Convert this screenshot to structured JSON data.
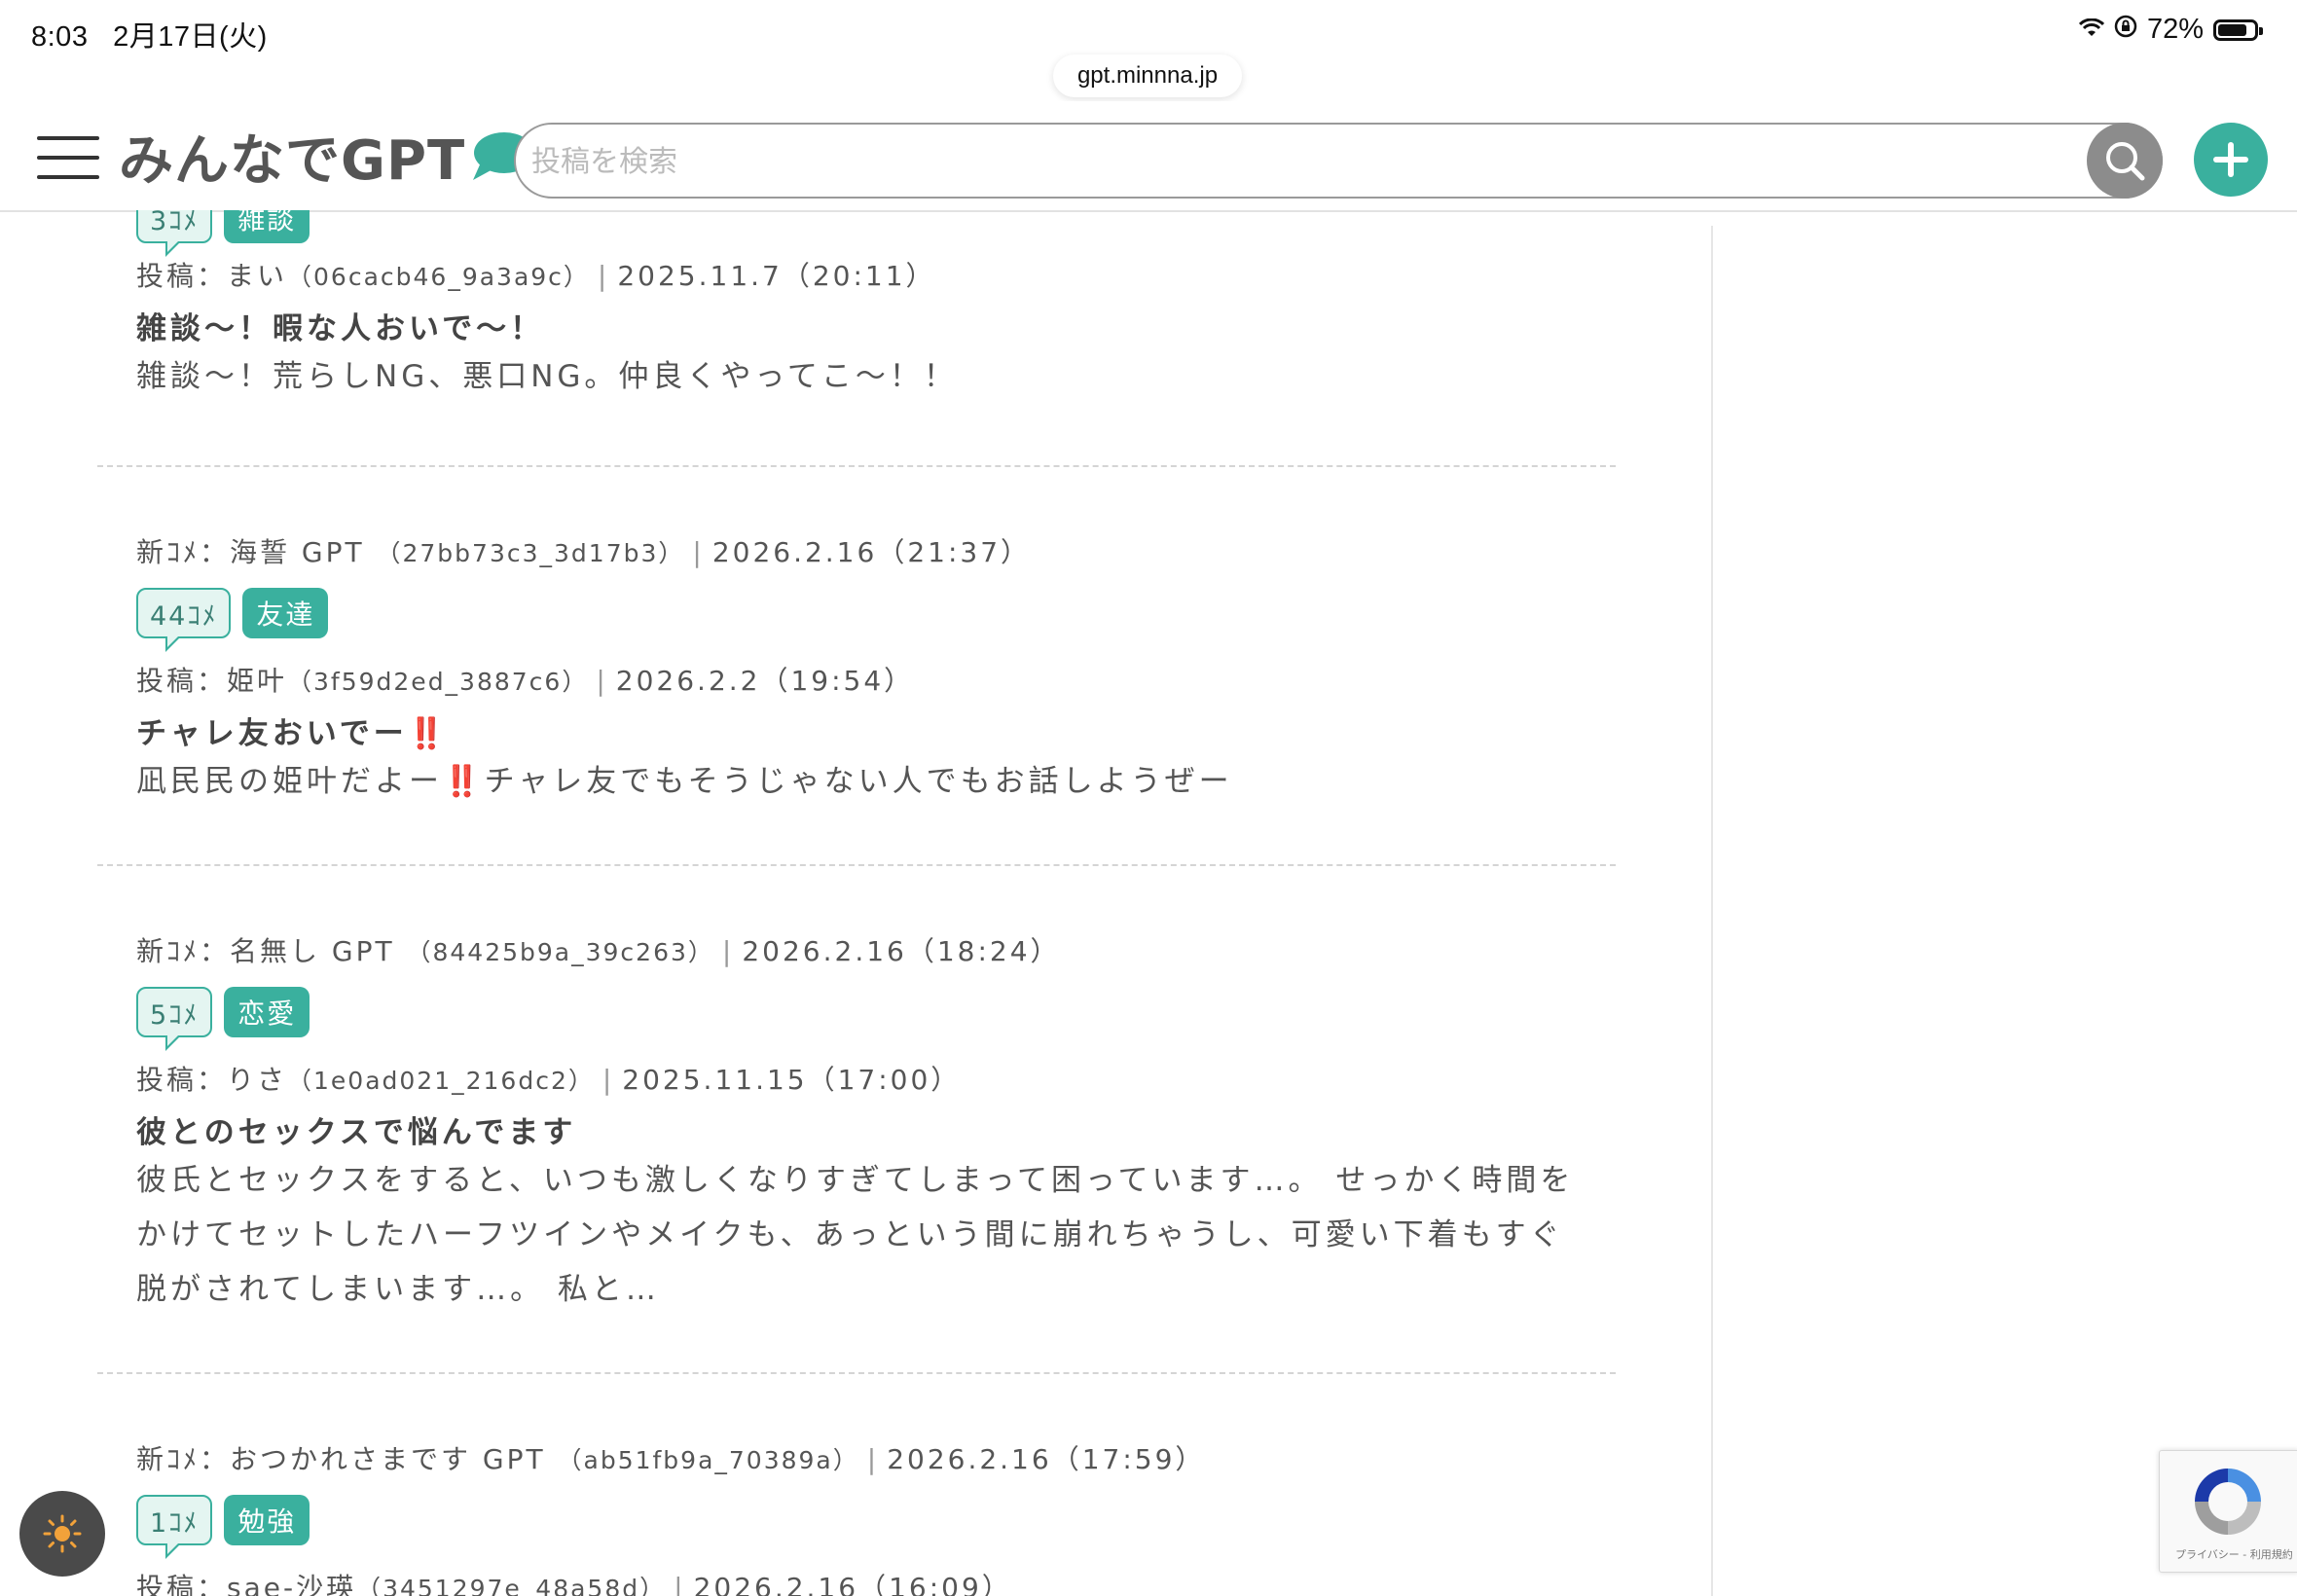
{
  "status_bar": {
    "time": "8:03",
    "date": "2月17日(火)",
    "battery": "72%",
    "url": "gpt.minnna.jp"
  },
  "header": {
    "logo": "みんなでGPT",
    "search_placeholder": "投稿を検索",
    "accent": "#3ab09e"
  },
  "posts": [
    {
      "comment_count": "3ｺﾒ",
      "category": "雑談",
      "poster_prefix": "投稿：まい",
      "poster_id": "（06cacb46_9a3a9c）",
      "posted_at": "2025.11.7（20:11）",
      "title": "雑談〜！暇な人おいで〜！",
      "body": "雑談〜！荒らしNG、悪口NG。仲良くやってこ〜！！"
    },
    {
      "latest_prefix": "新ｺﾒ：海誓 GPT",
      "latest_id": "（27bb73c3_3d17b3）",
      "latest_at": "2026.2.16（21:37）",
      "comment_count": "44ｺﾒ",
      "category": "友達",
      "poster_prefix": "投稿：姫叶",
      "poster_id": "（3f59d2ed_3887c6）",
      "posted_at": "2026.2.2（19:54）",
      "title": "チャレ友おいでー",
      "title_emoji": "‼️",
      "body_a": "凪民民の姫叶だよー",
      "body_emoji": "‼️",
      "body_b": "チャレ友でもそうじゃない人でもお話しようぜー"
    },
    {
      "latest_prefix": "新ｺﾒ：名無し GPT",
      "latest_id": "（84425b9a_39c263）",
      "latest_at": "2026.2.16（18:24）",
      "comment_count": "5ｺﾒ",
      "category": "恋愛",
      "poster_prefix": "投稿：りさ",
      "poster_id": "（1e0ad021_216dc2）",
      "posted_at": "2025.11.15（17:00）",
      "title": "彼とのセックスで悩んでます",
      "body": "彼氏とセックスをすると、いつも激しくなりすぎてしまって困っています…。 せっかく時間をかけてセットしたハーフツインやメイクも、あっという間に崩れちゃうし、可愛い下着もすぐ脱がされてしまいます…。 私と…"
    },
    {
      "latest_prefix": "新ｺﾒ：おつかれさまです GPT",
      "latest_id": "（ab51fb9a_70389a）",
      "latest_at": "2026.2.16（17:59）",
      "comment_count": "1ｺﾒ",
      "category": "勉強",
      "poster_prefix": "投稿：sae-沙瑛",
      "poster_id": "（3451297e_48a58d）",
      "posted_at": "2026.2.16（16:09）"
    }
  ],
  "recaptcha": {
    "text": "プライバシー - 利用規約"
  }
}
